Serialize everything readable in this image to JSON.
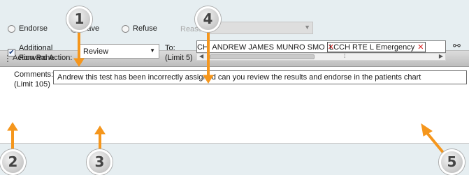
{
  "pane": {
    "title": "Action Pane"
  },
  "options": {
    "endorse": "Endorse",
    "save": "Save",
    "refuse": "Refuse",
    "reason_label": "Reason"
  },
  "forward": {
    "checkbox_checked": true,
    "label_line1": "Additional",
    "label_line2": "Forward Action:",
    "selected_action": "Review"
  },
  "to": {
    "label_line1": "To:",
    "label_line2": "(Limit 5)",
    "recipients": [
      {
        "name": "CH, ANDREW JAMES MUNRO SMO"
      },
      {
        "name": "LCCH RTE L Emergency"
      }
    ]
  },
  "comments": {
    "label_line1": "Comments:",
    "label_line2": "(Limit 105)",
    "value": "Andrew this test has been incorrectly assigned can you review the results and endorse in the patients chart"
  },
  "callouts": [
    "1",
    "2",
    "3",
    "4",
    "5"
  ],
  "colors": {
    "arrow": "#f5961c",
    "header": "#c9c9c9"
  }
}
